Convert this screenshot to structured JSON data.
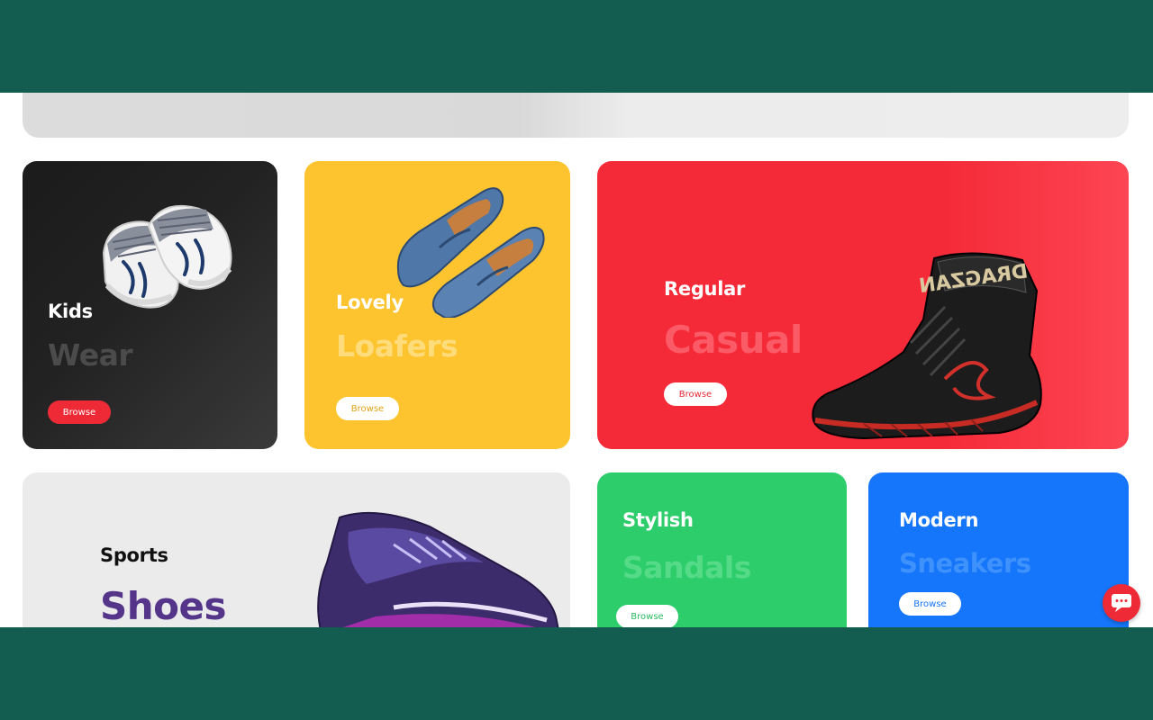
{
  "categories": [
    {
      "id": "kids",
      "eyebrow": "Kids",
      "title": "Wear",
      "button": "Browse"
    },
    {
      "id": "loafers",
      "eyebrow": "Lovely",
      "title": "Loafers",
      "button": "Browse"
    },
    {
      "id": "casual",
      "eyebrow": "Regular",
      "title": "Casual",
      "button": "Browse",
      "brand_text": "DRAGZAN"
    },
    {
      "id": "sports",
      "eyebrow": "Sports",
      "title": "Shoes"
    },
    {
      "id": "sandals",
      "eyebrow": "Stylish",
      "title": "Sandals",
      "button": "Browse"
    },
    {
      "id": "sneakers",
      "eyebrow": "Modern",
      "title": "Sneakers",
      "button": "Browse"
    }
  ],
  "icons": {
    "chat": "chat-bubble-icon",
    "kids_image": "baby-shoes-image",
    "loafers_image": "blue-loafers-image",
    "casual_image": "black-high-top-sneaker-image",
    "sports_image": "purple-sports-shoes-image"
  },
  "colors": {
    "frame": "#135c50",
    "kids_bg": "#1f1f1f",
    "loafers_bg": "#fdc42f",
    "casual_bg": "#f52a38",
    "sports_bg": "#ebebeb",
    "sandals_bg": "#2dcd6b",
    "sneakers_bg": "#1576fb",
    "accent": "#ee2a36"
  }
}
